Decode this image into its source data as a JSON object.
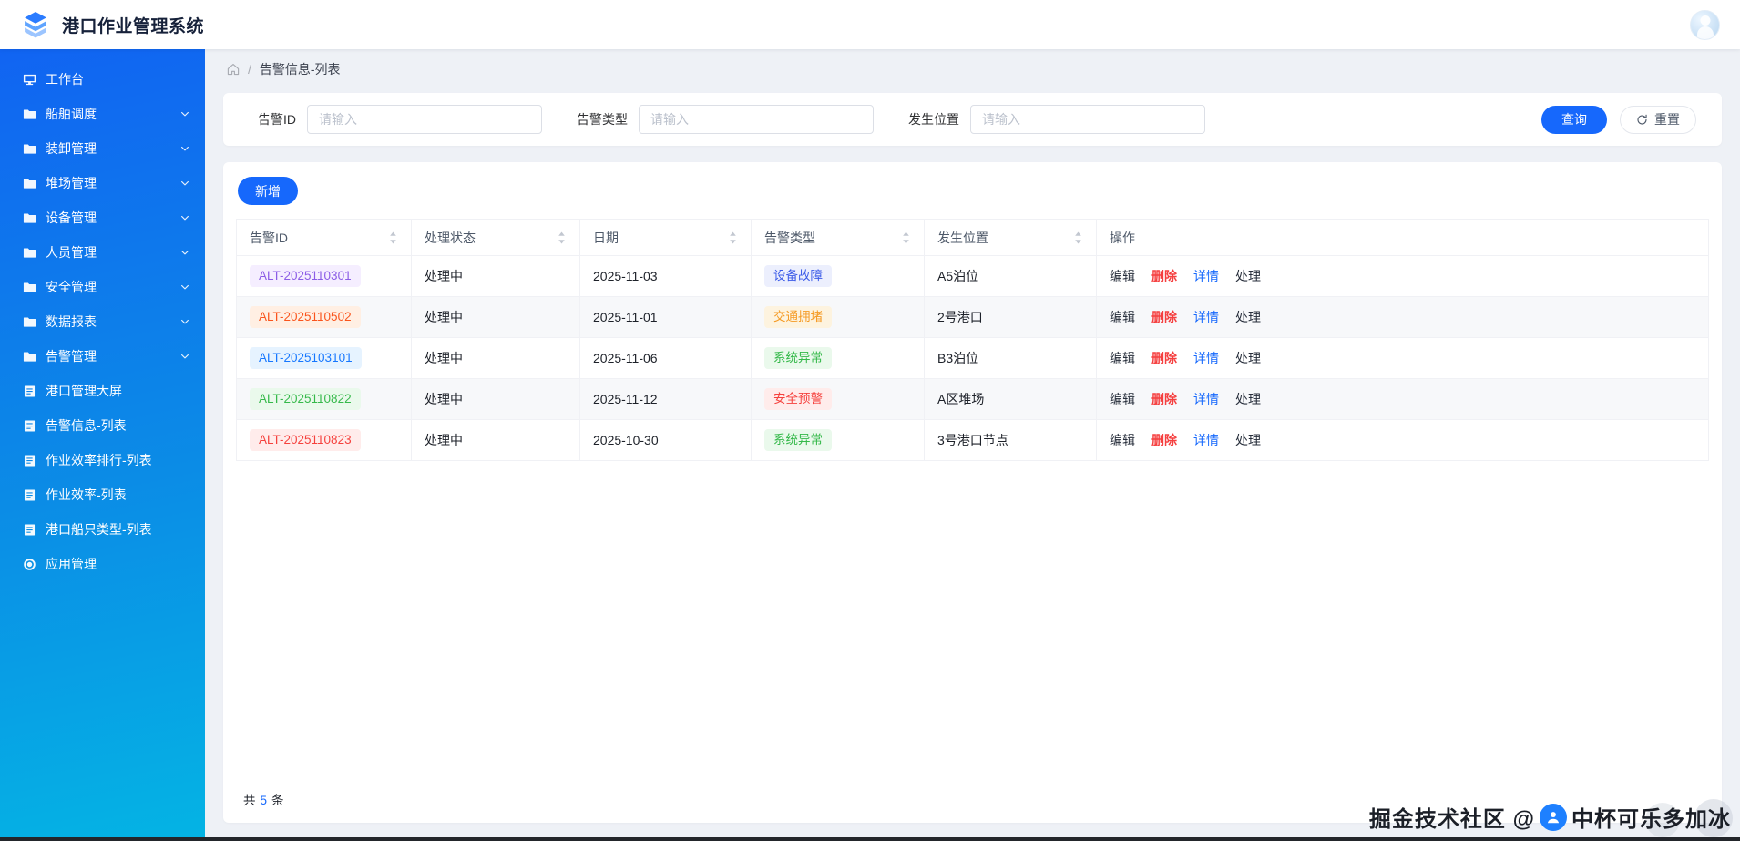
{
  "app": {
    "title": "港口作业管理系统"
  },
  "sidebar": {
    "items": [
      {
        "label": "工作台",
        "icon": "desktop",
        "expandable": false
      },
      {
        "label": "船舶调度",
        "icon": "folder",
        "expandable": true
      },
      {
        "label": "装卸管理",
        "icon": "folder",
        "expandable": true
      },
      {
        "label": "堆场管理",
        "icon": "folder",
        "expandable": true
      },
      {
        "label": "设备管理",
        "icon": "folder",
        "expandable": true
      },
      {
        "label": "人员管理",
        "icon": "folder",
        "expandable": true
      },
      {
        "label": "安全管理",
        "icon": "folder",
        "expandable": true
      },
      {
        "label": "数据报表",
        "icon": "folder",
        "expandable": true
      },
      {
        "label": "告警管理",
        "icon": "folder",
        "expandable": true
      },
      {
        "label": "港口管理大屏",
        "icon": "doc",
        "expandable": false
      },
      {
        "label": "告警信息-列表",
        "icon": "doc",
        "expandable": false
      },
      {
        "label": "作业效率排行-列表",
        "icon": "doc",
        "expandable": false
      },
      {
        "label": "作业效率-列表",
        "icon": "doc",
        "expandable": false
      },
      {
        "label": "港口船只类型-列表",
        "icon": "doc",
        "expandable": false
      },
      {
        "label": "应用管理",
        "icon": "app",
        "expandable": false
      }
    ]
  },
  "breadcrumb": {
    "separator": "/",
    "current": "告警信息-列表"
  },
  "filters": {
    "fields": [
      {
        "key": "alarm-id",
        "label": "告警ID",
        "placeholder": "请输入"
      },
      {
        "key": "alarm-type",
        "label": "告警类型",
        "placeholder": "请输入"
      },
      {
        "key": "location",
        "label": "发生位置",
        "placeholder": "请输入"
      }
    ],
    "search_label": "查询",
    "reset_label": "重置"
  },
  "toolbar": {
    "add_label": "新增"
  },
  "table": {
    "columns": [
      {
        "label": "告警ID",
        "sortable": true
      },
      {
        "label": "处理状态",
        "sortable": true
      },
      {
        "label": "日期",
        "sortable": true
      },
      {
        "label": "告警类型",
        "sortable": true
      },
      {
        "label": "发生位置",
        "sortable": true
      },
      {
        "label": "操作",
        "sortable": false
      }
    ],
    "actions": [
      {
        "kind": "edit",
        "label": "编辑"
      },
      {
        "kind": "delete",
        "label": "删除"
      },
      {
        "kind": "detail",
        "label": "详情"
      },
      {
        "kind": "handle",
        "label": "处理"
      }
    ],
    "rows": [
      {
        "id": "ALT-2025110301",
        "id_tone": "purple",
        "status": "处理中",
        "date": "2025-11-03",
        "type": "设备故障",
        "type_tone": "indigo",
        "location": "A5泊位"
      },
      {
        "id": "ALT-2025110502",
        "id_tone": "orange-red",
        "status": "处理中",
        "date": "2025-11-01",
        "type": "交通拥堵",
        "type_tone": "orange",
        "location": "2号港口"
      },
      {
        "id": "ALT-2025103101",
        "id_tone": "blue",
        "status": "处理中",
        "date": "2025-11-06",
        "type": "系统异常",
        "type_tone": "green",
        "location": "B3泊位"
      },
      {
        "id": "ALT-2025110822",
        "id_tone": "green",
        "status": "处理中",
        "date": "2025-11-12",
        "type": "安全预警",
        "type_tone": "red",
        "location": "A区堆场"
      },
      {
        "id": "ALT-2025110823",
        "id_tone": "red",
        "status": "处理中",
        "date": "2025-10-30",
        "type": "系统异常",
        "type_tone": "green",
        "location": "3号港口节点"
      }
    ],
    "footer": {
      "prefix": "共",
      "count": "5",
      "suffix": "条"
    }
  },
  "watermark": {
    "prefix": "掘金技术社区 @",
    "name": "中杯可乐多加冰"
  },
  "colors": {
    "primary": "#1668fc",
    "sidebar_top": "#1164f2",
    "sidebar_bottom": "#04b4e4",
    "delete_red": "#f53f3f",
    "badge_purple": "#8b5ce6",
    "badge_blue": "#1677ff",
    "badge_green": "#35b94a",
    "badge_red": "#f5413d",
    "badge_orange": "#f59a23"
  }
}
